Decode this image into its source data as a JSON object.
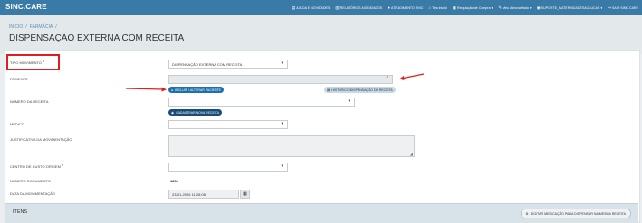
{
  "app": {
    "brand": "SINC.CARE"
  },
  "topnav": [
    {
      "icon": "book-icon",
      "glyph": "▤",
      "label": "AJUDA E NOVIDADES"
    },
    {
      "icon": "report-icon",
      "glyph": "▥",
      "label": "RELATÓRIOS AGENDADOS"
    },
    {
      "icon": "support-icon",
      "glyph": "●",
      "label": "ATENDIMENTO SINC"
    },
    {
      "icon": "home-icon",
      "glyph": "⌂",
      "label": "Tela inicial"
    },
    {
      "icon": "cart-icon",
      "glyph": "▣",
      "label": "Requisição de Compra ▾"
    },
    {
      "icon": "edit-icon",
      "glyph": "✎",
      "label": "Meu Almoxarifado ▾"
    },
    {
      "icon": "user-icon",
      "glyph": "◉",
      "label": "SUPORTE_MATERNIDADESAOLUCAS ▾"
    },
    {
      "icon": "logout-icon",
      "glyph": "↪",
      "label": "SAIR SINC.CARE"
    }
  ],
  "breadcrumb": {
    "home": "INÍCIO",
    "sep1": "/",
    "section": "FARMÁCIA",
    "sep2": "/"
  },
  "page_title": "DISPENSAÇÃO EXTERNA COM RECEITA",
  "form": {
    "tipo_movimento": {
      "label": "TIPO MOVIMENTO",
      "required": "*",
      "value": "DISPENSAÇÃO EXTERNA COM RECEITA"
    },
    "paciente": {
      "label": "PACIENTE",
      "value": ""
    },
    "btn_incluir": "INCLUIR / ALTERAR PACIENTE",
    "btn_historico": "HISTÓRICO DISPENSAÇÃO DE RECEITA",
    "numero_receita": {
      "label": "NÚMERO DA RECEITA",
      "value": ""
    },
    "btn_cadastrar": "CADASTRAR NOVA RECEITA",
    "medico": {
      "label": "MÉDICO",
      "value": ""
    },
    "justificativa": {
      "label": "JUSTIFICATIVA DA MOVIMENTAÇÃO",
      "value": ""
    },
    "centro_custo": {
      "label": "CENTRO DE CUSTO ORIGEM",
      "required": "*",
      "value": ""
    },
    "numero_documento": {
      "label": "NÚMERO DOCUMENTO",
      "value": "1890"
    },
    "data_movimentacao": {
      "label": "DATA DA MOVIMENTAÇÃO",
      "value": "23-01-2026 11:26:08"
    }
  },
  "itens": {
    "title": "ITENS",
    "btn_digitar": "DIGITAR MEDICAÇÃO PARA DISPENSAR NA MESMA RECEITA"
  },
  "colors": {
    "topbar": "#3a7aa7",
    "annotation_red": "#e01e1e",
    "button_blue": "#1f6fae"
  }
}
